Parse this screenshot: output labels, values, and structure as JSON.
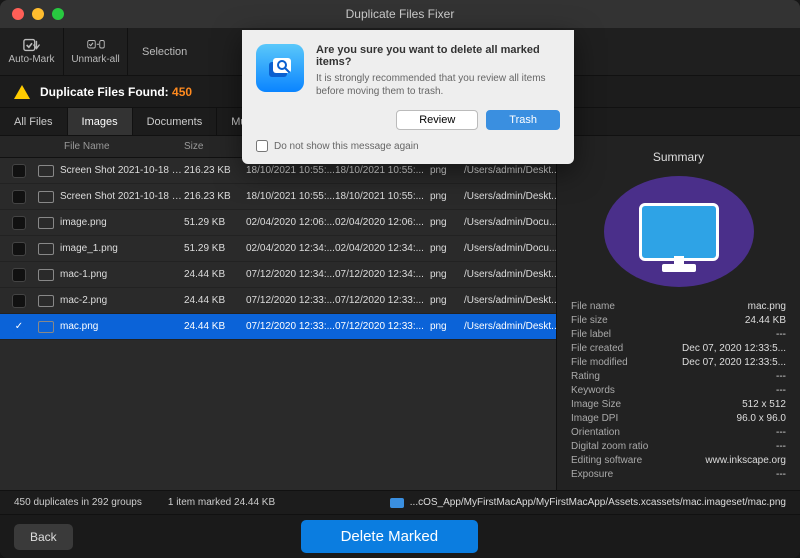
{
  "window_title": "Duplicate Files Fixer",
  "toolbar": {
    "automark": "Auto-Mark",
    "unmarkall": "Unmark-all",
    "selection": "Selection"
  },
  "found": {
    "label": "Duplicate Files Found: ",
    "count": "450"
  },
  "tabs": {
    "all": "All Files",
    "images": "Images",
    "documents": "Documents",
    "music": "Music"
  },
  "columns": {
    "name": "File Name",
    "size": "Size"
  },
  "rows": [
    {
      "checked": false,
      "name": "Screen Shot 2021-10-18 a...",
      "size": "216.23 KB",
      "d1": "18/10/2021 10:55:...",
      "d2": "18/10/2021 10:55:...",
      "type": "png",
      "path": "/Users/admin/Deskt..."
    },
    {
      "checked": false,
      "name": "Screen Shot 2021-10-18 a...",
      "size": "216.23 KB",
      "d1": "18/10/2021 10:55:...",
      "d2": "18/10/2021 10:55:...",
      "type": "png",
      "path": "/Users/admin/Deskt..."
    },
    {
      "checked": false,
      "name": "image.png",
      "size": "51.29 KB",
      "d1": "02/04/2020 12:06:...",
      "d2": "02/04/2020 12:06:...",
      "type": "png",
      "path": "/Users/admin/Docu..."
    },
    {
      "checked": false,
      "name": "image_1.png",
      "size": "51.29 KB",
      "d1": "02/04/2020 12:34:...",
      "d2": "02/04/2020 12:34:...",
      "type": "png",
      "path": "/Users/admin/Docu..."
    },
    {
      "checked": false,
      "name": "mac-1.png",
      "size": "24.44 KB",
      "d1": "07/12/2020 12:34:...",
      "d2": "07/12/2020 12:34:...",
      "type": "png",
      "path": "/Users/admin/Deskt..."
    },
    {
      "checked": false,
      "name": "mac-2.png",
      "size": "24.44 KB",
      "d1": "07/12/2020 12:33:...",
      "d2": "07/12/2020 12:33:...",
      "type": "png",
      "path": "/Users/admin/Deskt..."
    },
    {
      "checked": true,
      "selected": true,
      "name": "mac.png",
      "size": "24.44 KB",
      "d1": "07/12/2020 12:33:...",
      "d2": "07/12/2020 12:33:...",
      "type": "png",
      "path": "/Users/admin/Deskt..."
    }
  ],
  "summary": {
    "title": "Summary",
    "meta": {
      "File name": "mac.png",
      "File size": "24.44 KB",
      "File label": "---",
      "File created": "Dec 07, 2020 12:33:5...",
      "File modified": "Dec 07, 2020 12:33:5...",
      "Rating": "---",
      "Keywords": "---",
      "Image Size": "512 x 512",
      "Image DPI": "96.0 x 96.0",
      "Orientation": "---",
      "Digital zoom ratio": "---",
      "Editing software": "www.inkscape.org",
      "Exposure": "---"
    }
  },
  "status": {
    "dup": "450 duplicates in 292 groups",
    "marked": "1 item marked 24.44 KB",
    "path": "...cOS_App/MyFirstMacApp/MyFirstMacApp/Assets.xcassets/mac.imageset/mac.png"
  },
  "bottom": {
    "back": "Back",
    "delete": "Delete Marked"
  },
  "modal": {
    "title": "Are you sure you want to delete all marked items?",
    "desc": "It is strongly recommended that you review all items before moving them to trash.",
    "review": "Review",
    "trash": "Trash",
    "dontshow": "Do not show this message again"
  }
}
